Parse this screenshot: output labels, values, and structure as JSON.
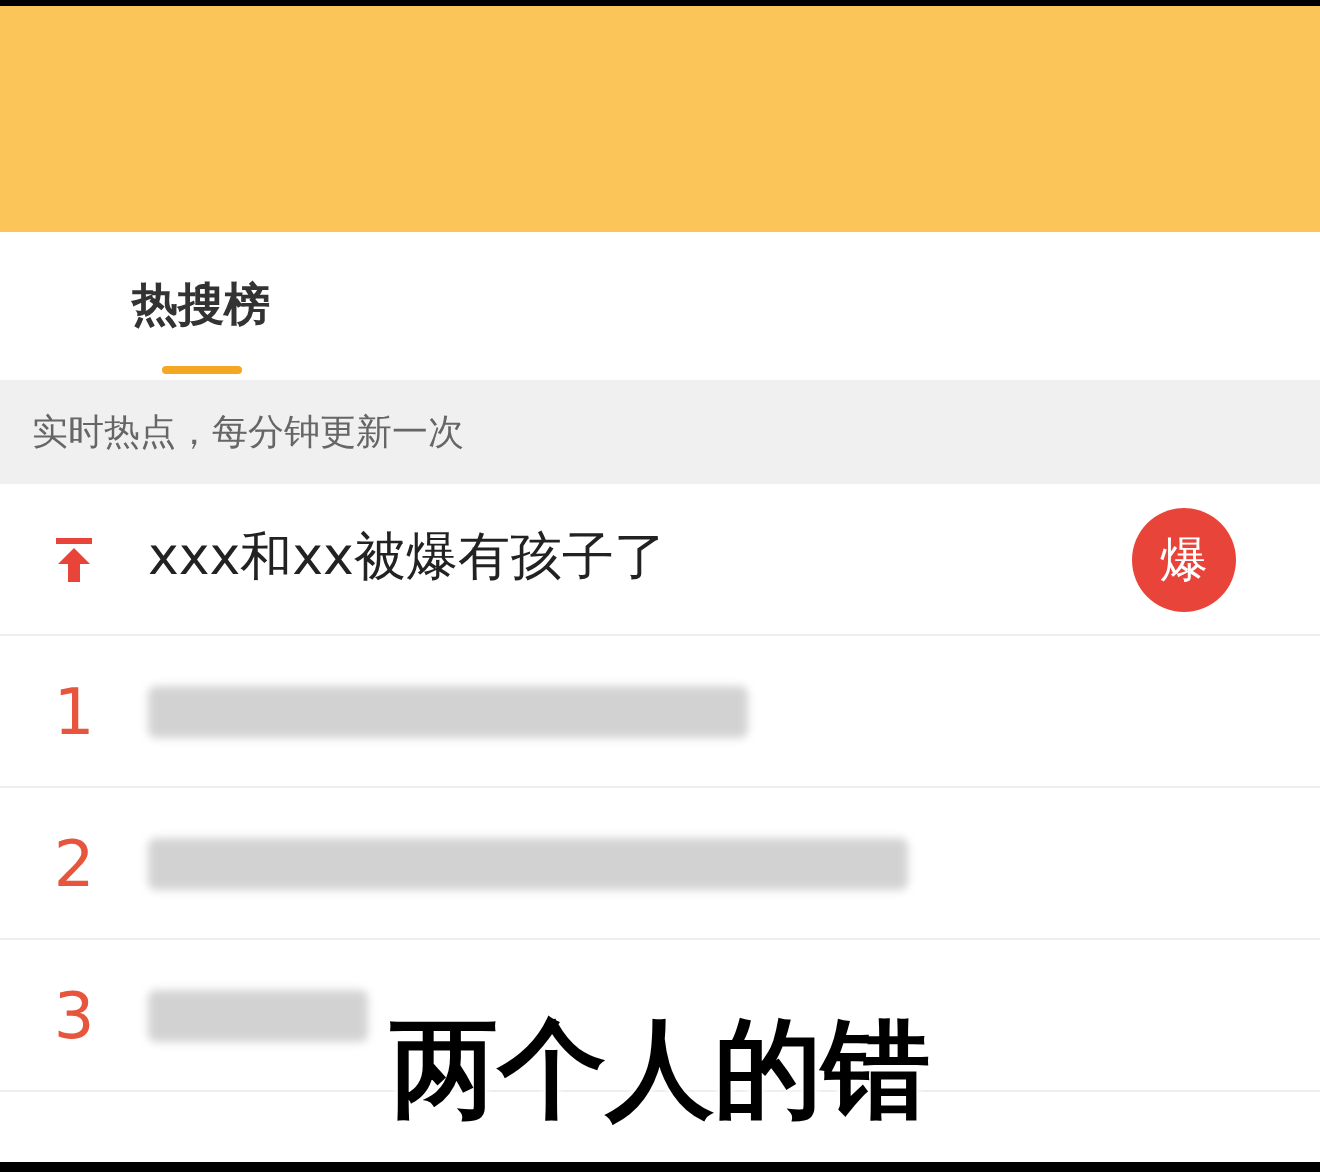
{
  "tabs": [
    {
      "label": "热搜榜",
      "selected": true
    }
  ],
  "notice": "实时热点，每分钟更新一次",
  "rows": [
    {
      "kind": "pinned",
      "title": "xxx和xx被爆有孩子了",
      "badge": "爆"
    },
    {
      "kind": "blurred",
      "rank": "1"
    },
    {
      "kind": "blurred",
      "rank": "2"
    },
    {
      "kind": "blurred",
      "rank": "3"
    }
  ],
  "caption": "两个人的错"
}
